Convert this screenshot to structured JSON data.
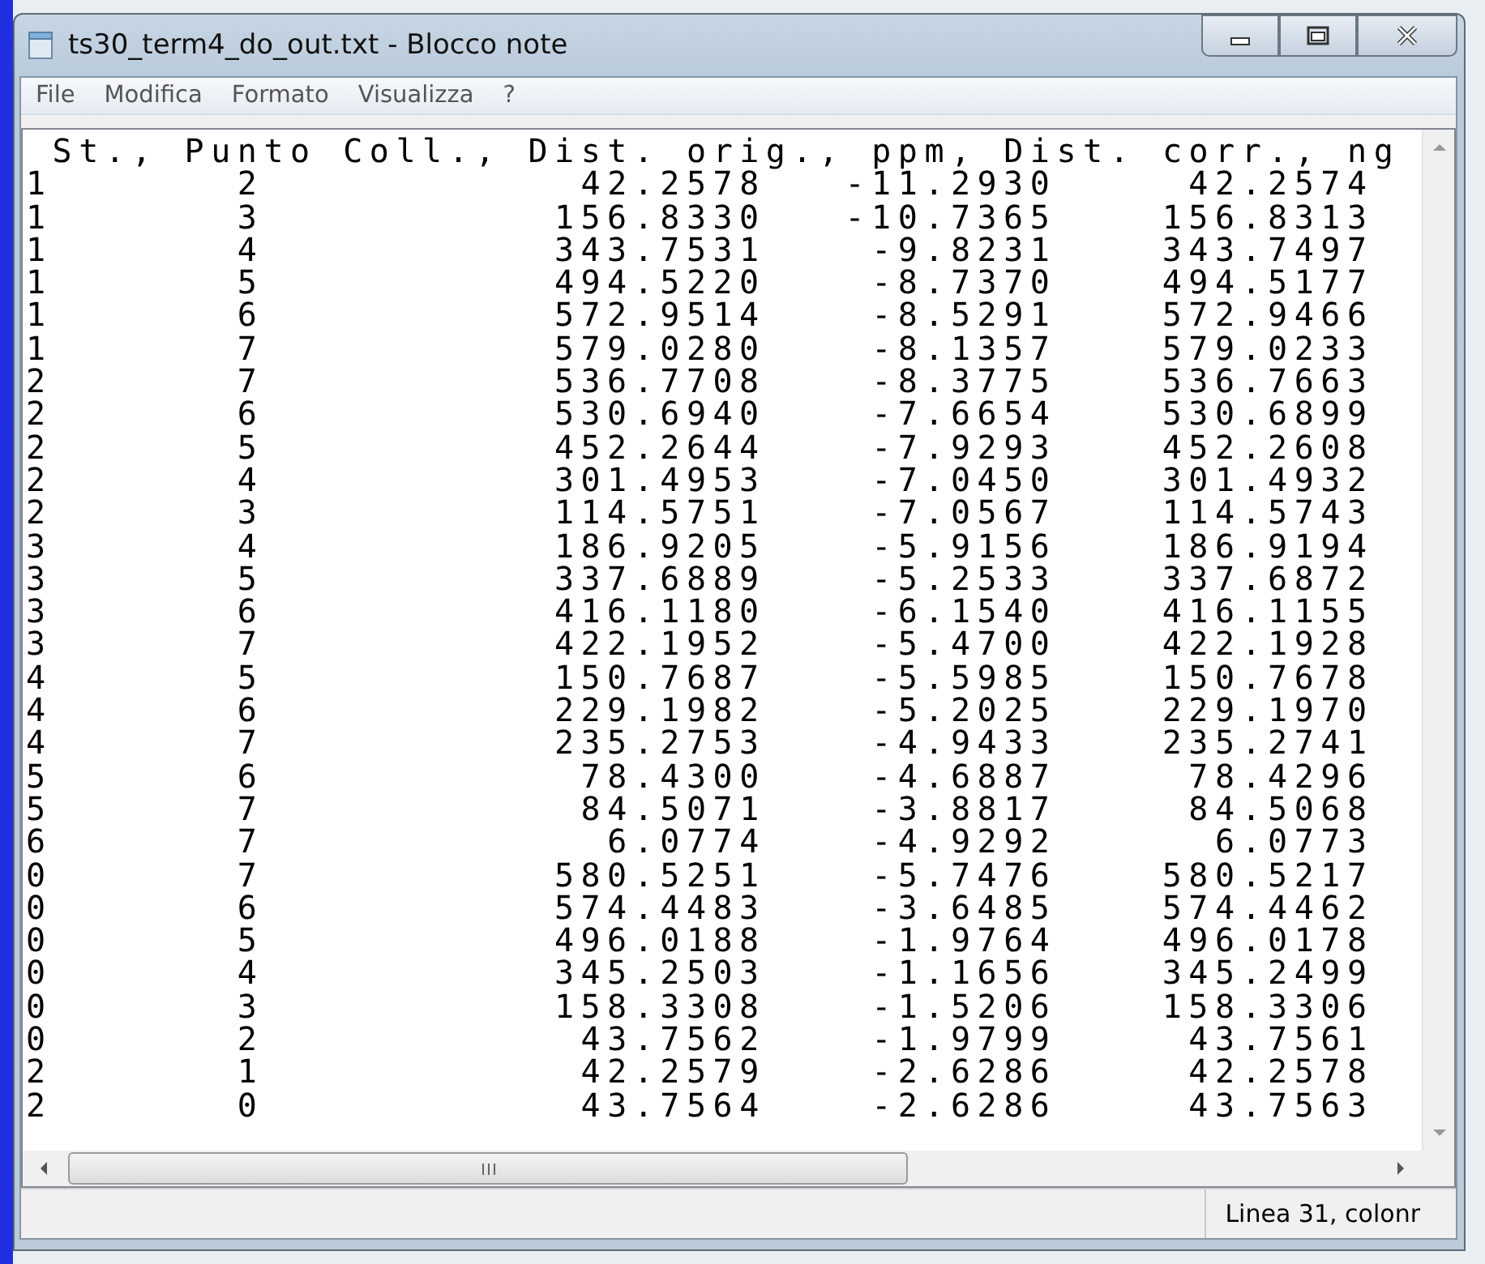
{
  "window": {
    "title": "ts30_term4_do_out.txt - Blocco note"
  },
  "menu": [
    "File",
    "Modifica",
    "Formato",
    "Visualizza",
    "?"
  ],
  "editor": {
    "header": "St., Punto Coll., Dist. orig., ppm, Dist. corr., ng",
    "rows": [
      {
        "st": "1",
        "punto": "2",
        "dist_orig": "42.2578",
        "ppm": "-11.2930",
        "dist_corr": "42.2574"
      },
      {
        "st": "1",
        "punto": "3",
        "dist_orig": "156.8330",
        "ppm": "-10.7365",
        "dist_corr": "156.8313"
      },
      {
        "st": "1",
        "punto": "4",
        "dist_orig": "343.7531",
        "ppm": "-9.8231",
        "dist_corr": "343.7497"
      },
      {
        "st": "1",
        "punto": "5",
        "dist_orig": "494.5220",
        "ppm": "-8.7370",
        "dist_corr": "494.5177"
      },
      {
        "st": "1",
        "punto": "6",
        "dist_orig": "572.9514",
        "ppm": "-8.5291",
        "dist_corr": "572.9466"
      },
      {
        "st": "1",
        "punto": "7",
        "dist_orig": "579.0280",
        "ppm": "-8.1357",
        "dist_corr": "579.0233"
      },
      {
        "st": "2",
        "punto": "7",
        "dist_orig": "536.7708",
        "ppm": "-8.3775",
        "dist_corr": "536.7663"
      },
      {
        "st": "2",
        "punto": "6",
        "dist_orig": "530.6940",
        "ppm": "-7.6654",
        "dist_corr": "530.6899"
      },
      {
        "st": "2",
        "punto": "5",
        "dist_orig": "452.2644",
        "ppm": "-7.9293",
        "dist_corr": "452.2608"
      },
      {
        "st": "2",
        "punto": "4",
        "dist_orig": "301.4953",
        "ppm": "-7.0450",
        "dist_corr": "301.4932"
      },
      {
        "st": "2",
        "punto": "3",
        "dist_orig": "114.5751",
        "ppm": "-7.0567",
        "dist_corr": "114.5743"
      },
      {
        "st": "3",
        "punto": "4",
        "dist_orig": "186.9205",
        "ppm": "-5.9156",
        "dist_corr": "186.9194"
      },
      {
        "st": "3",
        "punto": "5",
        "dist_orig": "337.6889",
        "ppm": "-5.2533",
        "dist_corr": "337.6872"
      },
      {
        "st": "3",
        "punto": "6",
        "dist_orig": "416.1180",
        "ppm": "-6.1540",
        "dist_corr": "416.1155"
      },
      {
        "st": "3",
        "punto": "7",
        "dist_orig": "422.1952",
        "ppm": "-5.4700",
        "dist_corr": "422.1928"
      },
      {
        "st": "4",
        "punto": "5",
        "dist_orig": "150.7687",
        "ppm": "-5.5985",
        "dist_corr": "150.7678"
      },
      {
        "st": "4",
        "punto": "6",
        "dist_orig": "229.1982",
        "ppm": "-5.2025",
        "dist_corr": "229.1970"
      },
      {
        "st": "4",
        "punto": "7",
        "dist_orig": "235.2753",
        "ppm": "-4.9433",
        "dist_corr": "235.2741"
      },
      {
        "st": "5",
        "punto": "6",
        "dist_orig": "78.4300",
        "ppm": "-4.6887",
        "dist_corr": "78.4296"
      },
      {
        "st": "5",
        "punto": "7",
        "dist_orig": "84.5071",
        "ppm": "-3.8817",
        "dist_corr": "84.5068"
      },
      {
        "st": "6",
        "punto": "7",
        "dist_orig": "6.0774",
        "ppm": "-4.9292",
        "dist_corr": "6.0773"
      },
      {
        "st": "0",
        "punto": "7",
        "dist_orig": "580.5251",
        "ppm": "-5.7476",
        "dist_corr": "580.5217"
      },
      {
        "st": "0",
        "punto": "6",
        "dist_orig": "574.4483",
        "ppm": "-3.6485",
        "dist_corr": "574.4462"
      },
      {
        "st": "0",
        "punto": "5",
        "dist_orig": "496.0188",
        "ppm": "-1.9764",
        "dist_corr": "496.0178"
      },
      {
        "st": "0",
        "punto": "4",
        "dist_orig": "345.2503",
        "ppm": "-1.1656",
        "dist_corr": "345.2499"
      },
      {
        "st": "0",
        "punto": "3",
        "dist_orig": "158.3308",
        "ppm": "-1.5206",
        "dist_corr": "158.3306"
      },
      {
        "st": "0",
        "punto": "2",
        "dist_orig": "43.7562",
        "ppm": "-1.9799",
        "dist_corr": "43.7561"
      },
      {
        "st": "2",
        "punto": "1",
        "dist_orig": "42.2579",
        "ppm": "-2.6286",
        "dist_corr": "42.2578"
      },
      {
        "st": "2",
        "punto": "0",
        "dist_orig": "43.7564",
        "ppm": "-2.6286",
        "dist_corr": "43.7563"
      }
    ]
  },
  "status_bar": {
    "position": "Linea 31, colonr"
  }
}
